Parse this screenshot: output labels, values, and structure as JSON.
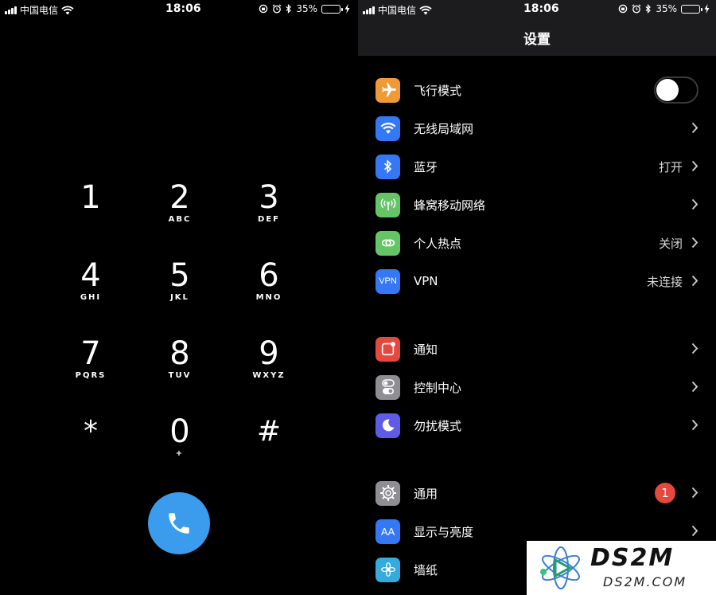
{
  "status_bar": {
    "carrier": "中国电信",
    "time": "18:06",
    "battery": "35%",
    "battery_fraction": 0.35
  },
  "dialer": {
    "keys": [
      {
        "digit": "1",
        "letters": ""
      },
      {
        "digit": "2",
        "letters": "ABC"
      },
      {
        "digit": "3",
        "letters": "DEF"
      },
      {
        "digit": "4",
        "letters": "GHI"
      },
      {
        "digit": "5",
        "letters": "JKL"
      },
      {
        "digit": "6",
        "letters": "MNO"
      },
      {
        "digit": "7",
        "letters": "PQRS"
      },
      {
        "digit": "8",
        "letters": "TUV"
      },
      {
        "digit": "9",
        "letters": "WXYZ"
      },
      {
        "digit": "*",
        "letters": ""
      },
      {
        "digit": "0",
        "letters": "+"
      },
      {
        "digit": "#",
        "letters": ""
      }
    ],
    "call_icon": "phone-icon",
    "call_color": "#3b9ced"
  },
  "settings": {
    "title": "设置",
    "groups": [
      [
        {
          "label": "飞行模式",
          "icon": "airplane-icon",
          "color": "#f09a37",
          "toggle": true,
          "toggle_on": false
        },
        {
          "label": "无线局域网",
          "icon": "wifi-icon",
          "color": "#3478f6",
          "value": ""
        },
        {
          "label": "蓝牙",
          "icon": "bluetooth-icon",
          "color": "#3478f6",
          "value": "打开"
        },
        {
          "label": "蜂窝移动网络",
          "icon": "cellular-icon",
          "color": "#65c466",
          "value": ""
        },
        {
          "label": "个人热点",
          "icon": "hotspot-icon",
          "color": "#65c466",
          "value": "关闭"
        },
        {
          "label": "VPN",
          "icon": "vpn-icon",
          "icon_text": "VPN",
          "color": "#3478f6",
          "value": "未连接"
        }
      ],
      [
        {
          "label": "通知",
          "icon": "notifications-icon",
          "color": "#e5483d",
          "value": ""
        },
        {
          "label": "控制中心",
          "icon": "control-center-icon",
          "color": "#8e8e93",
          "value": ""
        },
        {
          "label": "勿扰模式",
          "icon": "moon-icon",
          "color": "#5e5ce6",
          "value": ""
        }
      ],
      [
        {
          "label": "通用",
          "icon": "gear-icon",
          "color": "#8e8e93",
          "value": "",
          "badge": "1"
        },
        {
          "label": "显示与亮度",
          "icon": "display-brightness-icon",
          "icon_text": "AA",
          "color": "#3478f6",
          "value": ""
        },
        {
          "label": "墙纸",
          "icon": "wallpaper-icon",
          "color": "#35aadc",
          "value": ""
        }
      ]
    ]
  },
  "watermark": {
    "name": "DS2M",
    "domain": "DS2M.COM"
  }
}
